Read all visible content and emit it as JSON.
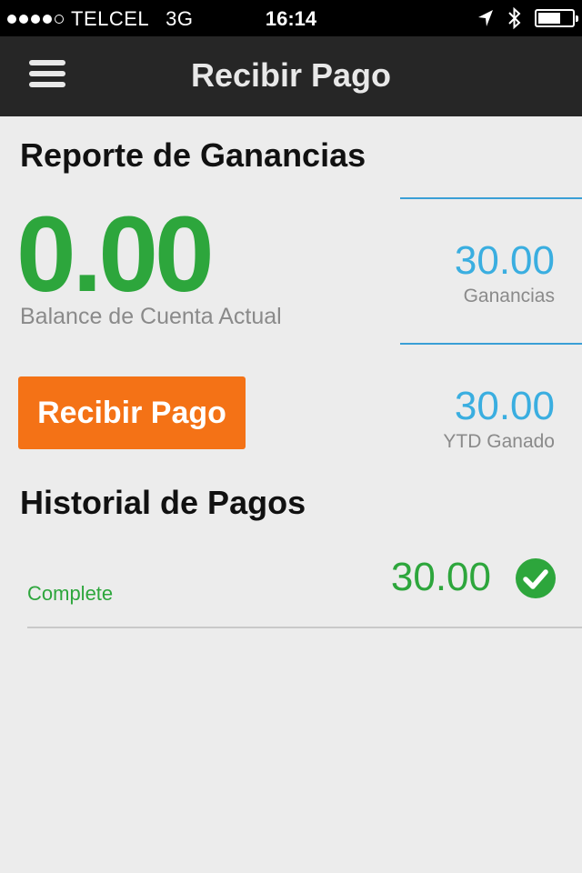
{
  "status_bar": {
    "carrier": "TELCEL",
    "network": "3G",
    "time": "16:14"
  },
  "nav": {
    "title": "Recibir Pago"
  },
  "report": {
    "title": "Reporte de Ganancias",
    "balance": "0.00",
    "balance_label": "Balance de Cuenta Actual",
    "earnings_value": "30.00",
    "earnings_label": "Ganancias",
    "ytd_value": "30.00",
    "ytd_label": "YTD Ganado",
    "button_label": "Recibir Pago"
  },
  "history": {
    "title": "Historial de Pagos",
    "items": [
      {
        "status": "Complete",
        "amount": "30.00"
      }
    ]
  },
  "colors": {
    "green": "#2da63c",
    "blue": "#3aaee0",
    "orange": "#f47216",
    "navbar": "#262626"
  }
}
